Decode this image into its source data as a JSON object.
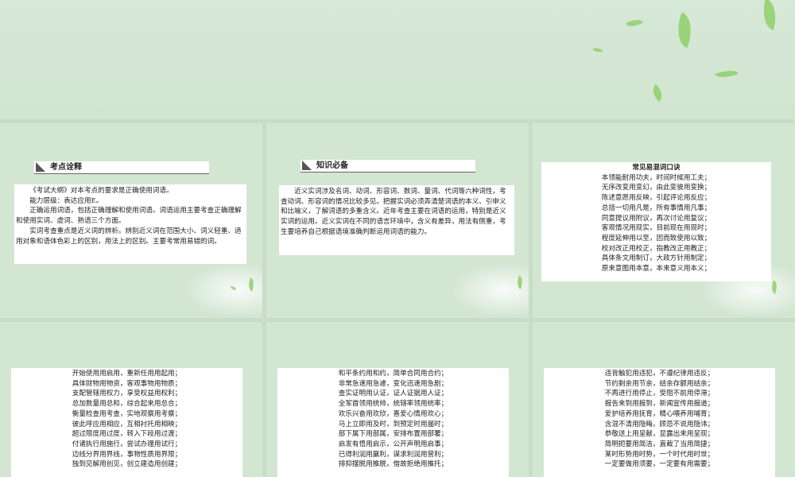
{
  "slide1": {
    "heading": "考点诠释",
    "paragraphs": [
      "《考试大纲》对本考点的要求是正确使用词语。",
      "能力层级：表达应用E。",
      "正确运用词语，包括正确理解和使用词语。词语运用主要考查正确理解和使用实词、虚词、熟语三个方面。",
      "实词考查重点是近义词的辨析。辨别近义词在范围大小、词义轻重、适用对象和语体色彩上的区别，用法上的区别。主要考常用易错的词。"
    ]
  },
  "slide2": {
    "heading": "知识必备",
    "paragraph": "近义实词涉及名词、动词、形容词、数词、量词、代词等六种词性，考查动词、形容词的情况比较多见。把握实词必须弄清楚词语的本义、引申义和比喻义，了解词语的多重含义。近年考查主要在词语的运用，特别是近义实词的运用。近义实词在不同的语言环境中，含义有差异，用法有侧重，考生要培养自己根据语境准确判断运用词语的能力。"
  },
  "slide3": {
    "title": "常见易混词口诀",
    "lines": [
      "本领能耐用功夫，时间时候用工夫；",
      "无序改变用变幻，由此变彼用变换；",
      "陈述意愿用反映，引起评论用反应；",
      "总括一切用凡是，所有事情用凡事；",
      "同意提议用附议，再次讨论用复议；",
      "客观情况用现实，目前现在用现时；",
      "程度延伸用以至，因而致使用以致；",
      "校对改正用校正，指教改正用教正；",
      "具体条文用制订，大政方针用制定；",
      "原来意图用本意，本来意义用本义；"
    ]
  },
  "slide4": {
    "lines": [
      "开始使用用启用，重新任用用起用；",
      "具体财物用物资，客观事物用物质；",
      "支配管辖用权力，享受权益用权利；",
      "总加数量用总和，综合起来用总合；",
      "衡量检查用考查，实地观察用考察；",
      "彼此呼应用相应，互相衬托用相映；",
      "超过限度用过度，转入下段用过渡；",
      "付诸执行用施行，尝试办理用试行；",
      "边线分界用界线，事物性质用界限；",
      "独到见解用创见，创立建造用创建；"
    ]
  },
  "slide5": {
    "lines": [
      "和平条约用和约，简单合同用合约；",
      "非常急速用急遽，变化迅速用急剧；",
      "查实证明用认证，证人证据用人证；",
      "全军首领用统帅，统辖率领用统率；",
      "欢乐兴奋用欢欣，喜爱心情用欢心；",
      "马上立即用及时，到预定时用届时；",
      "部下属下用部属，安排布置用部署；",
      "启发有悟用启示，公开声明用启事；",
      "已得利润用赢利，谋求利润用营利；",
      "排抑摆脱用推脱，借故拒绝用推托；"
    ]
  },
  "slide6": {
    "lines": [
      "违背触犯用违犯，不遵纪律用违反；",
      "节约剩余用节余，结余存额用结余；",
      "不再进行用停止，受阻不前用停滞；",
      "报告来到用报到，新闻宣传用报道；",
      "爱护培养用抚育，精心喂养用哺育；",
      "含混不清用隐晦，顾忌不说用隐讳；",
      "恭敬送上用呈献，显露出来用呈现；",
      "简明扼要用简洁，直截了当用简捷；",
      "某时形势用时势，一个时代用时世；",
      "一定要做用须要，一定要有用需要；"
    ]
  }
}
